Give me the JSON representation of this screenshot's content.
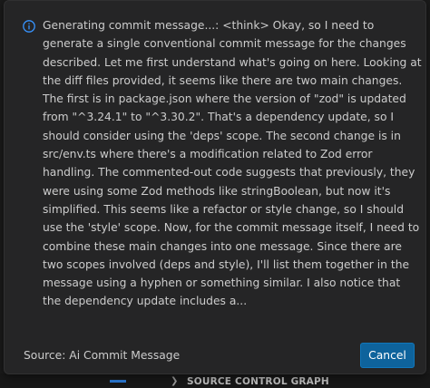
{
  "background": {
    "section_label": "SOURCE CONTROL GRAPH"
  },
  "dialog": {
    "icon": "info-icon",
    "message": "Generating commit message...: <think> Okay, so I need to generate a single conventional commit message for the changes described. Let me first understand what's going on here. Looking at the diff files provided, it seems like there are two main changes. The first is in package.json where the version of \"zod\" is updated from \"^3.24.1\" to \"^3.30.2\". That's a dependency update, so I should consider using the 'deps' scope. The second change is in src/env.ts where there's a modification related to Zod error handling. The commented-out code suggests that previously, they were using some Zod methods like stringBoolean, but now it's simplified. This seems like a refactor or style change, so I should use the 'style' scope. Now, for the commit message itself, I need to combine these main changes into one message. Since there are two scopes involved (deps and style), I'll list them together in the message using a hyphen or something similar. I also notice that the dependency update includes a...",
    "source": "Source: Ai Commit Message",
    "cancel_label": "Cancel"
  },
  "colors": {
    "dialog_bg": "#252526",
    "text": "#cccccc",
    "info_icon": "#3794ff",
    "button_bg": "#0e639c",
    "accent": "#2b79d4"
  }
}
